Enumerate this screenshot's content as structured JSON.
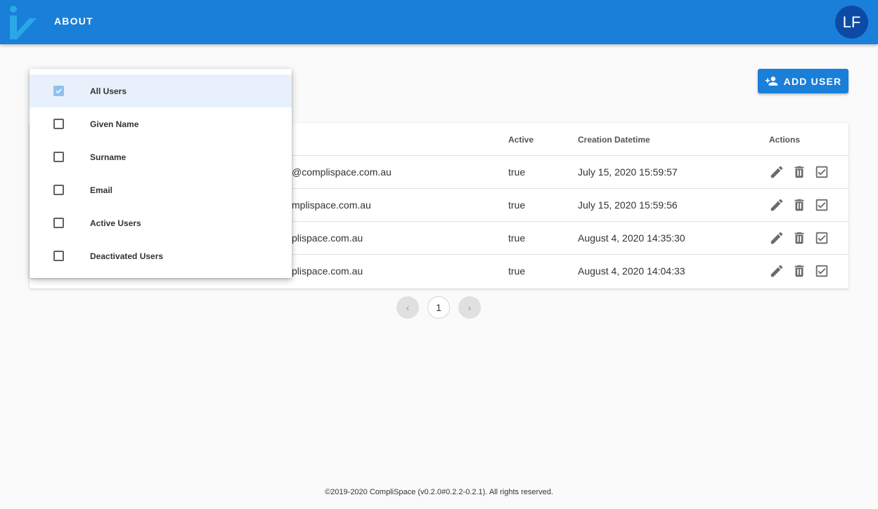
{
  "header": {
    "nav_about": "ABOUT",
    "avatar_initials": "LF",
    "accent_color": "#1a7fd8"
  },
  "toolbar": {
    "add_user_label": "ADD USER"
  },
  "filter_menu": {
    "items": [
      {
        "label": "All Users",
        "checked": true
      },
      {
        "label": "Given Name",
        "checked": false
      },
      {
        "label": "Surname",
        "checked": false
      },
      {
        "label": "Email",
        "checked": false
      },
      {
        "label": "Active Users",
        "checked": false
      },
      {
        "label": "Deactivated Users",
        "checked": false
      }
    ]
  },
  "table": {
    "columns": {
      "active": "Active",
      "created": "Creation Datetime",
      "actions": "Actions"
    },
    "rows": [
      {
        "email_visible": "@complispace.com.au",
        "active": "true",
        "created": "July 15, 2020 15:59:57"
      },
      {
        "email_visible": "mplispace.com.au",
        "active": "true",
        "created": "July 15, 2020 15:59:56"
      },
      {
        "email_visible": "plispace.com.au",
        "active": "true",
        "created": "August 4, 2020 14:35:30"
      },
      {
        "email_visible": "plispace.com.au",
        "active": "true",
        "created": "August 4, 2020 14:04:33"
      }
    ]
  },
  "pagination": {
    "prev": "‹",
    "current_page": "1",
    "next": "›"
  },
  "footer": {
    "text": "©2019-2020 CompliSpace (v0.2.0#0.2.2-0.2.1). All rights reserved."
  }
}
